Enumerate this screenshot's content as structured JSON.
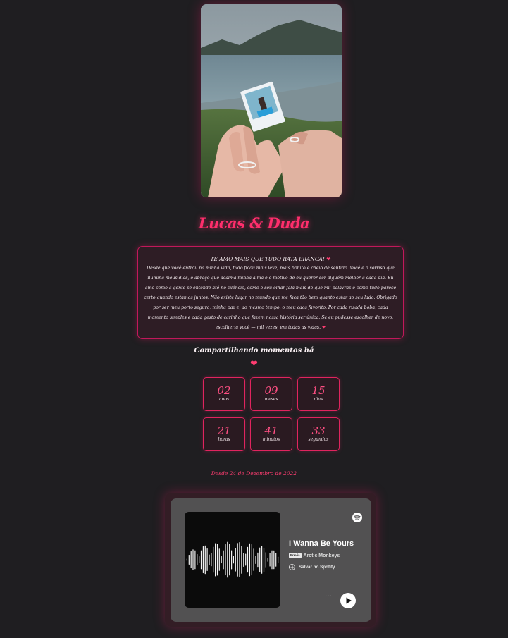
{
  "couple_name": "Lucas & Duda",
  "message": {
    "title": "TE AMO MAIS QUE TUDO RATA BRANCA!",
    "body": "Desde que você entrou na minha vida, tudo ficou mais leve, mais bonito e cheio de sentido. Você é o sorriso que ilumina meus dias, o abraço que acalma minha alma e o motivo de eu querer ser alguém melhor a cada dia. Eu amo como a gente se entende até no silêncio, como o seu olhar fala mais do que mil palavras e como tudo parece certo quando estamos juntos. Não existe lugar no mundo que me faça tão bem quanto estar ao seu lado. Obrigado por ser meu porto seguro, minha paz e, ao mesmo tempo, o meu caos favorito. Por cada risada boba, cada momento simples e cada gesto de carinho que fazem nossa história ser única. Se eu pudesse escolher de novo, escolheria você — mil vezes, em todas as vidas.",
    "heart": "❤"
  },
  "counter": {
    "label": "Compartilhando momentos há",
    "heart": "❤",
    "units": [
      {
        "value": "02",
        "label": "anos"
      },
      {
        "value": "09",
        "label": "meses"
      },
      {
        "value": "15",
        "label": "dias"
      },
      {
        "value": "21",
        "label": "horas"
      },
      {
        "value": "41",
        "label": "minutos"
      },
      {
        "value": "33",
        "label": "segundos"
      }
    ]
  },
  "since_text": "Desde 24 de Dezembro de 2022",
  "spotify": {
    "track_title": "I Wanna Be Yours",
    "preview_badge": "Prévia",
    "artist": "Arctic Monkeys",
    "save_label": "Salvar no Spotify",
    "more_label": "···",
    "icons": {
      "logo": "spotify-logo-icon",
      "save": "plus-circle-icon",
      "play": "play-icon"
    }
  },
  "colors": {
    "accent": "#ff2e6c",
    "background": "#1f1e21",
    "card": "#525152"
  }
}
